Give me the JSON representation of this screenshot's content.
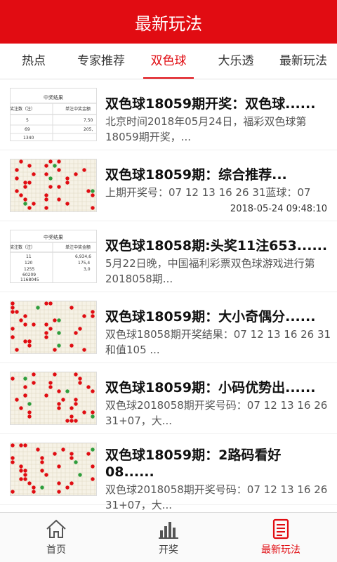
{
  "header": {
    "title": "最新玩法"
  },
  "tabs": [
    {
      "label": "热点"
    },
    {
      "label": "专家推荐"
    },
    {
      "label": "双色球",
      "active": true
    },
    {
      "label": "大乐透"
    },
    {
      "label": "最新玩法"
    }
  ],
  "articles": [
    {
      "thumb": "table-thumbnail",
      "thumb_text": "中奖结果",
      "thumb_col1": "中奖注数（注）",
      "thumb_col2": "单注中奖金额",
      "thumb_rows": [
        [
          "5",
          "7,50"
        ],
        [
          "69",
          "205,"
        ],
        [
          "1340",
          ""
        ]
      ],
      "title": "双色球18059期开奖：双色球......",
      "desc": "北京时间2018年05月24日，福彩双色球第18059期开奖，..."
    },
    {
      "thumb": "chart-thumbnail",
      "title": "双色球18059期：综合推荐...",
      "desc": "上期开奖号：07 12 13 16 26 31蓝球：07",
      "time": "2018-05-24 09:48:10"
    },
    {
      "thumb": "table-thumbnail",
      "thumb_text": "中奖结果",
      "thumb_col1": "中奖注数（注）",
      "thumb_col2": "单注中奖金额",
      "thumb_rows": [
        [
          "11",
          "6,934,6"
        ],
        [
          "120",
          "175,4"
        ],
        [
          "1255",
          "3,0"
        ],
        [
          "60209",
          ""
        ],
        [
          "1168045",
          ""
        ]
      ],
      "title": "双色球18058期:头奖11注653......",
      "desc": " 5月22日晚，中国福利彩票双色球游戏进行第2018058期..."
    },
    {
      "thumb": "chart-thumbnail",
      "title": "双色球18059期：大小奇偶分......",
      "desc": "双色球18058期开奖结果：07 12 13 16 26 31 和值105 ..."
    },
    {
      "thumb": "chart-thumbnail",
      "title": "双色球18059期：小码优势出......",
      "desc": " 双色球2018058期开奖号码：07 12 13 16 26 31+07，大..."
    },
    {
      "thumb": "chart-thumbnail",
      "title": "双色球18059期：2路码看好08......",
      "desc": "双色球2018058期开奖号码：07 12 13 16 26 31+07，大..."
    }
  ],
  "bottom_nav": [
    {
      "label": "首页",
      "icon": "home-icon"
    },
    {
      "label": "开奖",
      "icon": "bar-chart-icon"
    },
    {
      "label": "最新玩法",
      "icon": "document-icon",
      "active": true
    }
  ],
  "colors": {
    "brand_red": "#e10c12",
    "ball_green": "#2e9e3c"
  }
}
